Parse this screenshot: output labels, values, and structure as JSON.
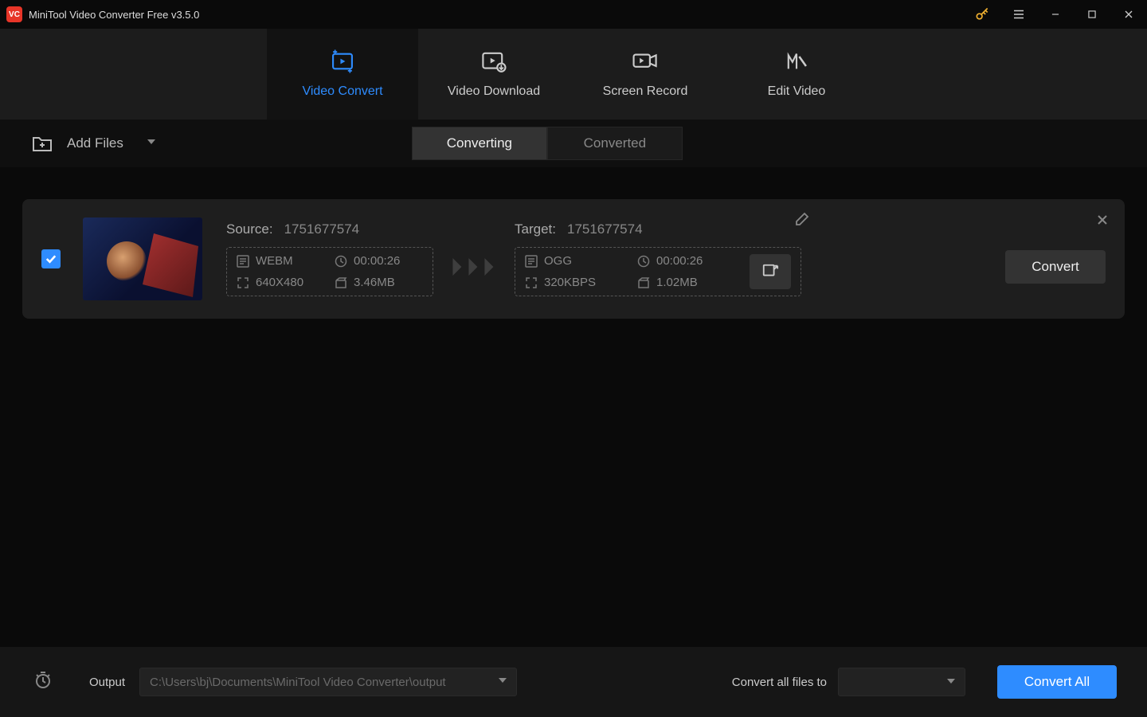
{
  "titlebar": {
    "app_icon_text": "VC",
    "title": "MiniTool Video Converter Free v3.5.0"
  },
  "main_tabs": [
    {
      "label": "Video Convert",
      "active": true,
      "icon": "convert"
    },
    {
      "label": "Video Download",
      "active": false,
      "icon": "download"
    },
    {
      "label": "Screen Record",
      "active": false,
      "icon": "record"
    },
    {
      "label": "Edit Video",
      "active": false,
      "icon": "edit"
    }
  ],
  "toolbar": {
    "add_files_label": "Add Files",
    "subtabs": {
      "converting": "Converting",
      "converted": "Converted",
      "active": "converting"
    }
  },
  "file_item": {
    "checked": true,
    "source": {
      "label": "Source:",
      "name": "1751677574",
      "format": "WEBM",
      "duration": "00:00:26",
      "resolution": "640X480",
      "size": "3.46MB"
    },
    "target": {
      "label": "Target:",
      "name": "1751677574",
      "format": "OGG",
      "duration": "00:00:26",
      "bitrate": "320KBPS",
      "size": "1.02MB"
    },
    "convert_label": "Convert"
  },
  "bottom": {
    "output_label": "Output",
    "output_path": "C:\\Users\\bj\\Documents\\MiniTool Video Converter\\output",
    "convert_all_files_label": "Convert all files to",
    "convert_all_label": "Convert All"
  }
}
